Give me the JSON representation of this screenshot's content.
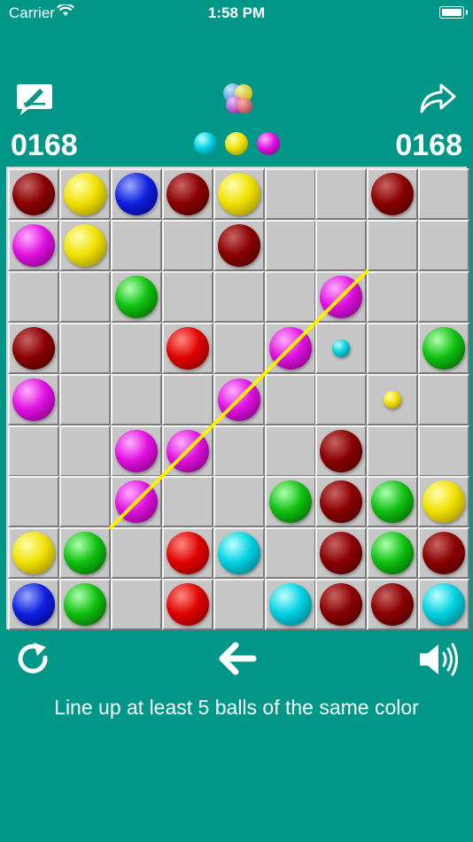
{
  "status_bar": {
    "carrier": "Carrier",
    "time": "1:58 PM"
  },
  "toolbar": {
    "left_icon": "edit-icon",
    "center_icon": "game-logo-icon",
    "right_icon": "share-icon"
  },
  "scores": {
    "left": "0168",
    "right": "0168"
  },
  "next_balls": [
    "cyan",
    "yellow",
    "magenta"
  ],
  "colors": {
    "red": [
      "#ff8a80",
      "#e00000",
      "#700000"
    ],
    "darkred": [
      "#c86464",
      "#8a0000",
      "#3a0000"
    ],
    "yellow": [
      "#ffffb0",
      "#f0e000",
      "#8a7a00"
    ],
    "blue": [
      "#9aa8ff",
      "#1020e0",
      "#00006a"
    ],
    "magenta": [
      "#ffb0ff",
      "#e010e0",
      "#6a006a"
    ],
    "green": [
      "#b0ffb0",
      "#10c010",
      "#005000"
    ],
    "cyan": [
      "#c0ffff",
      "#00d0e0",
      "#006870"
    ],
    "line": "#ffee00"
  },
  "board": {
    "cols": 9,
    "rows": 9,
    "balls": [
      {
        "r": 0,
        "c": 0,
        "color": "darkred",
        "size": "big"
      },
      {
        "r": 0,
        "c": 1,
        "color": "yellow",
        "size": "big"
      },
      {
        "r": 0,
        "c": 2,
        "color": "blue",
        "size": "big"
      },
      {
        "r": 0,
        "c": 3,
        "color": "darkred",
        "size": "big"
      },
      {
        "r": 0,
        "c": 4,
        "color": "yellow",
        "size": "big"
      },
      {
        "r": 0,
        "c": 7,
        "color": "darkred",
        "size": "big"
      },
      {
        "r": 1,
        "c": 0,
        "color": "magenta",
        "size": "big"
      },
      {
        "r": 1,
        "c": 1,
        "color": "yellow",
        "size": "big"
      },
      {
        "r": 1,
        "c": 4,
        "color": "darkred",
        "size": "big"
      },
      {
        "r": 2,
        "c": 2,
        "color": "green",
        "size": "big"
      },
      {
        "r": 2,
        "c": 6,
        "color": "magenta",
        "size": "big"
      },
      {
        "r": 3,
        "c": 0,
        "color": "darkred",
        "size": "big"
      },
      {
        "r": 3,
        "c": 3,
        "color": "red",
        "size": "big"
      },
      {
        "r": 3,
        "c": 5,
        "color": "magenta",
        "size": "big"
      },
      {
        "r": 3,
        "c": 6,
        "color": "cyan",
        "size": "small"
      },
      {
        "r": 3,
        "c": 8,
        "color": "green",
        "size": "big"
      },
      {
        "r": 4,
        "c": 0,
        "color": "magenta",
        "size": "big"
      },
      {
        "r": 4,
        "c": 4,
        "color": "magenta",
        "size": "big"
      },
      {
        "r": 4,
        "c": 7,
        "color": "yellow",
        "size": "small"
      },
      {
        "r": 5,
        "c": 2,
        "color": "magenta",
        "size": "big"
      },
      {
        "r": 5,
        "c": 3,
        "color": "magenta",
        "size": "big"
      },
      {
        "r": 5,
        "c": 6,
        "color": "darkred",
        "size": "big"
      },
      {
        "r": 6,
        "c": 2,
        "color": "magenta",
        "size": "big"
      },
      {
        "r": 6,
        "c": 5,
        "color": "green",
        "size": "big"
      },
      {
        "r": 6,
        "c": 6,
        "color": "darkred",
        "size": "big"
      },
      {
        "r": 6,
        "c": 7,
        "color": "green",
        "size": "big"
      },
      {
        "r": 6,
        "c": 8,
        "color": "yellow",
        "size": "big"
      },
      {
        "r": 7,
        "c": 0,
        "color": "yellow",
        "size": "big"
      },
      {
        "r": 7,
        "c": 1,
        "color": "green",
        "size": "big"
      },
      {
        "r": 7,
        "c": 3,
        "color": "red",
        "size": "big"
      },
      {
        "r": 7,
        "c": 4,
        "color": "cyan",
        "size": "big"
      },
      {
        "r": 7,
        "c": 6,
        "color": "darkred",
        "size": "big"
      },
      {
        "r": 7,
        "c": 7,
        "color": "green",
        "size": "big"
      },
      {
        "r": 7,
        "c": 8,
        "color": "darkred",
        "size": "big"
      },
      {
        "r": 8,
        "c": 0,
        "color": "blue",
        "size": "big"
      },
      {
        "r": 8,
        "c": 1,
        "color": "green",
        "size": "big"
      },
      {
        "r": 8,
        "c": 3,
        "color": "red",
        "size": "big"
      },
      {
        "r": 8,
        "c": 5,
        "color": "cyan",
        "size": "big"
      },
      {
        "r": 8,
        "c": 6,
        "color": "darkred",
        "size": "big"
      },
      {
        "r": 8,
        "c": 7,
        "color": "darkred",
        "size": "big"
      },
      {
        "r": 8,
        "c": 8,
        "color": "cyan",
        "size": "big"
      }
    ],
    "line": {
      "from": {
        "r": 6,
        "c": 2
      },
      "to": {
        "r": 2,
        "c": 7
      }
    }
  },
  "controls": {
    "left_icon": "restart-icon",
    "center_icon": "undo-arrow-icon",
    "right_icon": "sound-icon"
  },
  "hint": "Line up at least 5 balls of the same color"
}
